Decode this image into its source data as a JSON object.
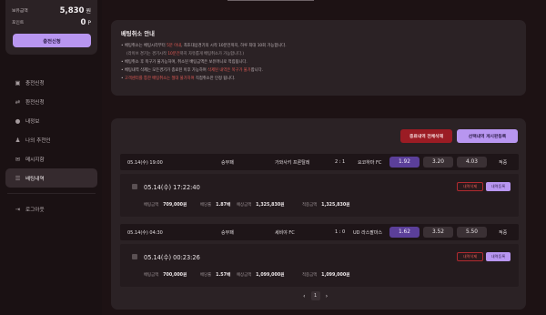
{
  "wallet": {
    "balance_label": "보유금액",
    "balance_value": "5,830",
    "balance_unit": "원",
    "points_label": "포인트",
    "points_value": "0",
    "points_unit": "P",
    "exchange_button": "충전신청"
  },
  "nav": {
    "items": [
      {
        "label": "충전신청",
        "icon": "wallet-icon"
      },
      {
        "label": "환전신청",
        "icon": "exchange-icon"
      },
      {
        "label": "내정보",
        "icon": "user-icon"
      },
      {
        "label": "나의 추천인",
        "icon": "users-icon"
      },
      {
        "label": "메시지함",
        "icon": "mail-icon"
      },
      {
        "label": "배팅내역",
        "icon": "list-icon"
      }
    ],
    "logout": "로그아웃"
  },
  "notice": {
    "title": "베팅취소 안내",
    "lines": [
      {
        "text_a": "베팅취소는 베팅시각부터 ",
        "text_red": "5분 이내",
        "text_b": ", 최초대상경기의 시작 10분전까지, 하루 최대 10회 가능합니다."
      },
      {
        "text_a": "(라이브 경기는 경기시작 ",
        "text_red": "10분전",
        "text_b": "까지 자유롭게 배팅취소가 가능합니다.)"
      },
      {
        "text_a": "베팅취소 후 복구가 불가능하며, 취소된 배팅금액은 보유머니로 적립됩니다.",
        "text_red": "",
        "text_b": ""
      },
      {
        "text_a": "베팅내역 삭제는 모든경기가 종료된 이후 가능하며 ",
        "text_red": "삭제된 내역은 복구가 불가",
        "text_b": "합니다."
      },
      {
        "text_a": "",
        "text_red": "고객센터를 통한 배팅취소는 절대 불가하며",
        "text_b": " 직접취소만 인정 됩니다."
      }
    ]
  },
  "actions": {
    "delete_all": "종료내역 전체삭제",
    "post_selected": "선택내역 게시판등록"
  },
  "bets": [
    {
      "time": "05.14(수) 19:00",
      "type": "승무패",
      "home": "가와사키 프론탈레",
      "score": "2 : 1",
      "away": "요코하마 FC",
      "odds": [
        "1.92",
        "3.20",
        "4.03"
      ],
      "result": "적중",
      "datetime": "05.14(수) 17:22:40",
      "stake_label": "배팅금액",
      "stake": "709,000원",
      "rate_label": "배당률",
      "rate": "1.87배",
      "expected_label": "예상금액",
      "expected": "1,325,830원",
      "win_label": "적중금액",
      "win": "1,325,830원",
      "delete_label": "내역삭제",
      "post_label": "내역등록"
    },
    {
      "time": "05.14(수) 04:30",
      "type": "승무패",
      "home": "세비야 FC",
      "score": "1 : 0",
      "away": "UD 라스팔마스",
      "odds": [
        "1.62",
        "3.52",
        "5.50"
      ],
      "result": "적중",
      "datetime": "05.14(수) 00:23:26",
      "stake_label": "배팅금액",
      "stake": "700,000원",
      "rate_label": "배당률",
      "rate": "1.57배",
      "expected_label": "예상금액",
      "expected": "1,099,000원",
      "win_label": "적중금액",
      "win": "1,099,000원",
      "delete_label": "내역삭제",
      "post_label": "내역등록"
    }
  ],
  "pagination": {
    "prev": "‹",
    "current": "1",
    "next": "›"
  }
}
